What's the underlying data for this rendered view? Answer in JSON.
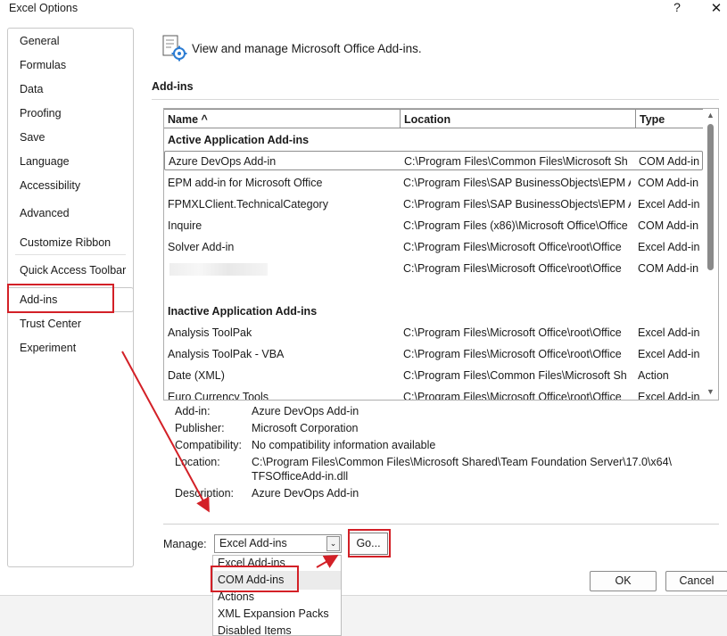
{
  "window": {
    "title": "Excel Options",
    "help_glyph": "?",
    "close_glyph": "✕"
  },
  "sidebar": {
    "items": [
      {
        "label": "General"
      },
      {
        "label": "Formulas"
      },
      {
        "label": "Data"
      },
      {
        "label": "Proofing"
      },
      {
        "label": "Save"
      },
      {
        "label": "Language"
      },
      {
        "label": "Accessibility"
      },
      {
        "label": "Advanced"
      },
      {
        "label": "Customize Ribbon"
      },
      {
        "label": "Quick Access Toolbar"
      },
      {
        "label": "Add-ins"
      },
      {
        "label": "Trust Center"
      },
      {
        "label": "Experiment"
      }
    ],
    "selected": "Add-ins"
  },
  "header": {
    "text": "View and manage Microsoft Office Add-ins.",
    "icon": "addins-gear-icon"
  },
  "addins": {
    "section_title": "Add-ins",
    "columns": [
      "Name ^",
      "Location",
      "Type"
    ],
    "active_group_title": "Active Application Add-ins",
    "active": [
      {
        "name": "Azure DevOps Add-in",
        "location": "C:\\Program Files\\Common Files\\Microsoft Sh",
        "type": "COM Add-in"
      },
      {
        "name": "EPM add-in for Microsoft Office",
        "location": "C:\\Program Files\\SAP BusinessObjects\\EPM A",
        "type": "COM Add-in"
      },
      {
        "name": "FPMXLClient.TechnicalCategory",
        "location": "C:\\Program Files\\SAP BusinessObjects\\EPM A",
        "type": "Excel Add-in"
      },
      {
        "name": "Inquire",
        "location": "C:\\Program Files (x86)\\Microsoft Office\\Office",
        "type": "COM Add-in"
      },
      {
        "name": "Solver Add-in",
        "location": "C:\\Program Files\\Microsoft Office\\root\\Office",
        "type": "Excel Add-in"
      },
      {
        "name": "",
        "location": "C:\\Program Files\\Microsoft Office\\root\\Office",
        "type": "COM Add-in"
      }
    ],
    "inactive_group_title": "Inactive Application Add-ins",
    "inactive": [
      {
        "name": "Analysis ToolPak",
        "location": "C:\\Program Files\\Microsoft Office\\root\\Office",
        "type": "Excel Add-in"
      },
      {
        "name": "Analysis ToolPak - VBA",
        "location": "C:\\Program Files\\Microsoft Office\\root\\Office",
        "type": "Excel Add-in"
      },
      {
        "name": "Date (XML)",
        "location": "C:\\Program Files\\Common Files\\Microsoft Sh",
        "type": "Action"
      },
      {
        "name": "Euro Currency Tools",
        "location": "C:\\Program Files\\Microsoft Office\\root\\Office",
        "type": "Excel Add-in"
      }
    ]
  },
  "details": {
    "addin_label": "Add-in:",
    "addin_value": "Azure DevOps Add-in",
    "publisher_label": "Publisher:",
    "publisher_value": "Microsoft Corporation",
    "compat_label": "Compatibility:",
    "compat_value": "No compatibility information available",
    "location_label": "Location:",
    "location_value_1": "C:\\Program Files\\Common Files\\Microsoft Shared\\Team Foundation Server\\17.0\\x64\\",
    "location_value_2": "TFSOfficeAdd-in.dll",
    "description_label": "Description:",
    "description_value": "Azure DevOps Add-in"
  },
  "manage": {
    "label": "Manage:",
    "selected": "Excel Add-ins",
    "go_label": "Go...",
    "options": [
      "Excel Add-ins",
      "COM Add-ins",
      "Actions",
      "XML Expansion Packs",
      "Disabled Items"
    ]
  },
  "buttons": {
    "ok": "OK",
    "cancel": "Cancel"
  },
  "colors": {
    "annotation_red": "#d32027"
  }
}
